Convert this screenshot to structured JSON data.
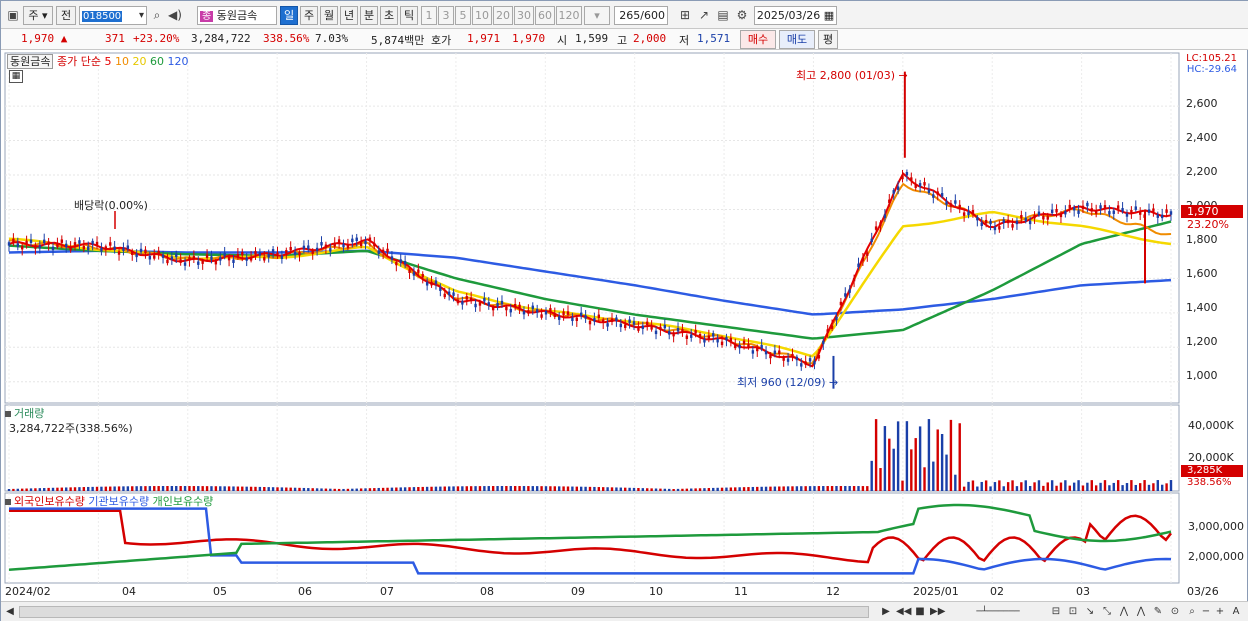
{
  "toolbar": {
    "market_mode": "주",
    "prev_label": "전",
    "stock_code": "018500",
    "stock_badge": "종",
    "stock_name": "동원금속",
    "periods": [
      "일",
      "주",
      "월",
      "년",
      "분",
      "초",
      "틱"
    ],
    "active_period": "일",
    "intervals": [
      "1",
      "3",
      "5",
      "10",
      "20",
      "30",
      "60",
      "120"
    ],
    "count": "265",
    "count_max": "/600",
    "date": "2025/03/26"
  },
  "quote": {
    "price": "1,970 ▲",
    "change": "371",
    "change_pct": "+23.20%",
    "volume": "3,284,722",
    "volume_ratio": "338.56%",
    "turnover": "7.03%",
    "amount": "5,874백만",
    "ask_label": "호가",
    "ask_price": "1,971",
    "bid_price": "1,970",
    "open_label": "시",
    "open": "1,599",
    "high_label": "고",
    "high": "2,000",
    "low_label": "저",
    "low": "1,571",
    "buy_button": "매수",
    "sell_button": "매도",
    "eval_button": "평"
  },
  "legend": {
    "name": "동원금속",
    "close_label": "종가 단순",
    "ma": [
      {
        "label": "5",
        "color": "#e60000"
      },
      {
        "label": "10",
        "color": "#f08c00"
      },
      {
        "label": "20",
        "color": "#f5d800"
      },
      {
        "label": "60",
        "color": "#1e9a3c"
      },
      {
        "label": "120",
        "color": "#2d5be3"
      }
    ]
  },
  "price_panel": {
    "lc": "LC:105.21",
    "hc": "HC:-29.64",
    "yticks": [
      "2,600",
      "2,400",
      "2,200",
      "2,000",
      "1,800",
      "1,600",
      "1,400",
      "1,200",
      "1,000"
    ],
    "last_price_tag": "1,970",
    "last_pct_tag": "23.20%",
    "annotation_high": "최고 2,800 (01/03)",
    "annotation_low": "최저 960 (12/09)",
    "annotation_dividend": "배당락(0.00%)"
  },
  "volume_panel": {
    "title": "거래량",
    "value": "3,284,722주(338.56%)",
    "yticks": [
      "40,000K",
      "20,000K"
    ],
    "tag_value": "3,285K",
    "tag_pct": "338.56%"
  },
  "holdings_panel": {
    "titles": [
      {
        "label": "외국인보유수량",
        "color": "#d40000"
      },
      {
        "label": "기관보유수량",
        "color": "#2d5be3"
      },
      {
        "label": "개인보유수량",
        "color": "#1e9a3c"
      }
    ],
    "yticks": [
      "3,000,000",
      "2,000,000"
    ]
  },
  "xaxis": {
    "labels": [
      "2024/02",
      "04",
      "05",
      "06",
      "07",
      "08",
      "09",
      "10",
      "11",
      "12",
      "2025/01",
      "02",
      "03",
      "03/26"
    ]
  },
  "chart_data": {
    "type": "line",
    "title": "동원금속",
    "ylim": [
      900,
      2850
    ],
    "x": [
      "2024/02",
      "04",
      "05",
      "06",
      "07",
      "08",
      "09",
      "10",
      "11",
      "12",
      "2025/01",
      "02",
      "03",
      "03/26"
    ],
    "series": [
      {
        "name": "5",
        "values": [
          1800,
          1790,
          1700,
          1740,
          1820,
          1480,
          1400,
          1330,
          1240,
          1100,
          2200,
          1900,
          2010,
          1970
        ]
      },
      {
        "name": "10",
        "values": [
          1810,
          1780,
          1710,
          1730,
          1800,
          1490,
          1400,
          1340,
          1250,
          1110,
          2150,
          1920,
          2000,
          1850
        ]
      },
      {
        "name": "20",
        "values": [
          1830,
          1770,
          1720,
          1720,
          1780,
          1520,
          1410,
          1350,
          1270,
          1150,
          1900,
          1980,
          1900,
          1800
        ]
      },
      {
        "name": "60",
        "values": [
          1790,
          1760,
          1740,
          1730,
          1760,
          1600,
          1480,
          1390,
          1320,
          1250,
          1300,
          1530,
          1800,
          1930
        ]
      },
      {
        "name": "120",
        "values": [
          1750,
          1760,
          1750,
          1750,
          1760,
          1720,
          1640,
          1560,
          1470,
          1390,
          1420,
          1480,
          1560,
          1590
        ]
      }
    ],
    "high": {
      "value": 2800,
      "date": "01/03"
    },
    "low": {
      "value": 960,
      "date": "12/09"
    },
    "last": 1970
  }
}
